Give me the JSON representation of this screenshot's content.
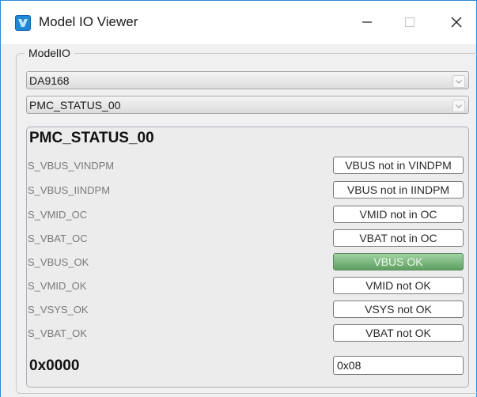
{
  "window": {
    "title": "Model IO Viewer",
    "icon": "app-icon",
    "controls": [
      "minimize-icon",
      "maximize-icon",
      "close-icon"
    ]
  },
  "group": {
    "legend": "ModelIO",
    "device_select": "DA9168",
    "register_select": "PMC_STATUS_00"
  },
  "register": {
    "name": "PMC_STATUS_00",
    "signals": [
      {
        "label": "S_VBUS_VINDPM",
        "value": "VBUS not in VINDPM",
        "active": false
      },
      {
        "label": "S_VBUS_IINDPM",
        "value": "VBUS not in IINDPM",
        "active": false
      },
      {
        "label": "S_VMID_OC",
        "value": "VMID not in OC",
        "active": false
      },
      {
        "label": "S_VBAT_OC",
        "value": "VBAT not in OC",
        "active": false
      },
      {
        "label": "S_VBUS_OK",
        "value": "VBUS  OK",
        "active": true
      },
      {
        "label": "S_VMID_OK",
        "value": "VMID not OK",
        "active": false
      },
      {
        "label": "S_VSYS_OK",
        "value": "VSYS not OK",
        "active": false
      },
      {
        "label": "S_VBAT_OK",
        "value": "VBAT not OK",
        "active": false
      }
    ],
    "hex_value": "0x0000",
    "raw_input": "0x08"
  },
  "colors": {
    "accent": "#1e88d6",
    "active_value": "#6fae71",
    "label_text": "#7a7a7a"
  }
}
